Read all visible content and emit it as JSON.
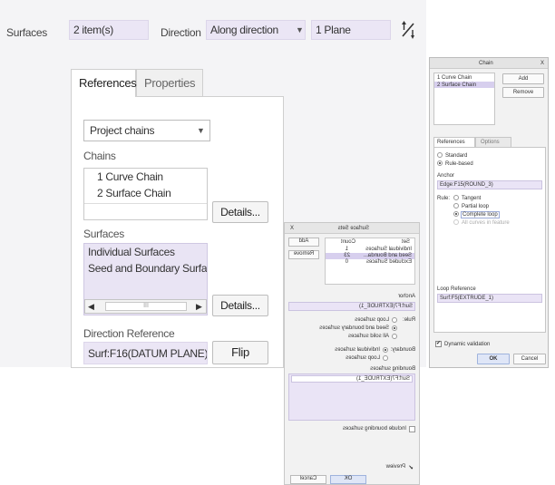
{
  "dashboard": {
    "surfaces_label": "Surfaces",
    "surfaces_value": "2 item(s)",
    "direction_label": "Direction",
    "direction_value": "Along direction",
    "plane_value": "1 Plane",
    "flip_icon": "flip-direction-icon"
  },
  "panel": {
    "tabs": [
      {
        "label": "References"
      },
      {
        "label": "Properties"
      }
    ],
    "chain_type": "Project chains",
    "chains_label": "Chains",
    "chains": [
      "1 Curve Chain",
      "2 Surface Chain"
    ],
    "details_label": "Details...",
    "surfaces_label": "Surfaces",
    "surfaces": [
      "Individual Surfaces",
      "Seed and Boundary Surfac"
    ],
    "scroll_thumb": "III",
    "direction_reference_label": "Direction Reference",
    "direction_reference_value": "Surf:F16(DATUM PLANE)",
    "flip_label": "Flip"
  },
  "surface_sets_dialog": {
    "title": "Surface Sets",
    "close": "X",
    "add_label": "Add",
    "remove_label": "Remove",
    "set_header": "Set",
    "count_header": "Count",
    "sets": [
      {
        "name": "Individual Surfaces",
        "count": "1"
      },
      {
        "name": "Seed and Bounda...",
        "count": "23"
      },
      {
        "name": "Excluded Surfaces",
        "count": "0"
      }
    ],
    "anchor_label": "Anchor",
    "anchor_value": "Surf:F7(EXTRUDE_1)",
    "rule_label": "Rule:",
    "rule_options": [
      "Loop surfaces",
      "Seed and boundary surfaces",
      "All solid surfaces"
    ],
    "boundary_label": "Boundary:",
    "boundary_options": [
      "Individual surfaces",
      "Loop surfaces"
    ],
    "bounding_label": "Bounding surfaces",
    "bounding_value": "Surf:F7(EXTRUDE_1)",
    "include_label": "Include bounding surfaces",
    "preview_label": "Preview",
    "ok_label": "OK",
    "cancel_label": "Cancel"
  },
  "chain_dialog": {
    "title": "Chain",
    "close": "X",
    "items": [
      "1 Curve Chain",
      "2 Surface Chain"
    ],
    "add_label": "Add",
    "remove_label": "Remove",
    "tabs": [
      "References",
      "Options"
    ],
    "options": [
      "Standard",
      "Rule-based"
    ],
    "anchor_label": "Anchor",
    "anchor_value": "Edge:F15(ROUND_3)",
    "rule_label": "Rule:",
    "rule_options": [
      "Tangent",
      "Partial loop",
      "Complete loop",
      "All curves in feature"
    ],
    "loop_reference_label": "Loop Reference",
    "loop_reference_value": "Surf:F5(EXTRUDE_1)",
    "dynamic_validation_label": "Dynamic validation",
    "ok_label": "OK",
    "cancel_label": "Cancel"
  }
}
